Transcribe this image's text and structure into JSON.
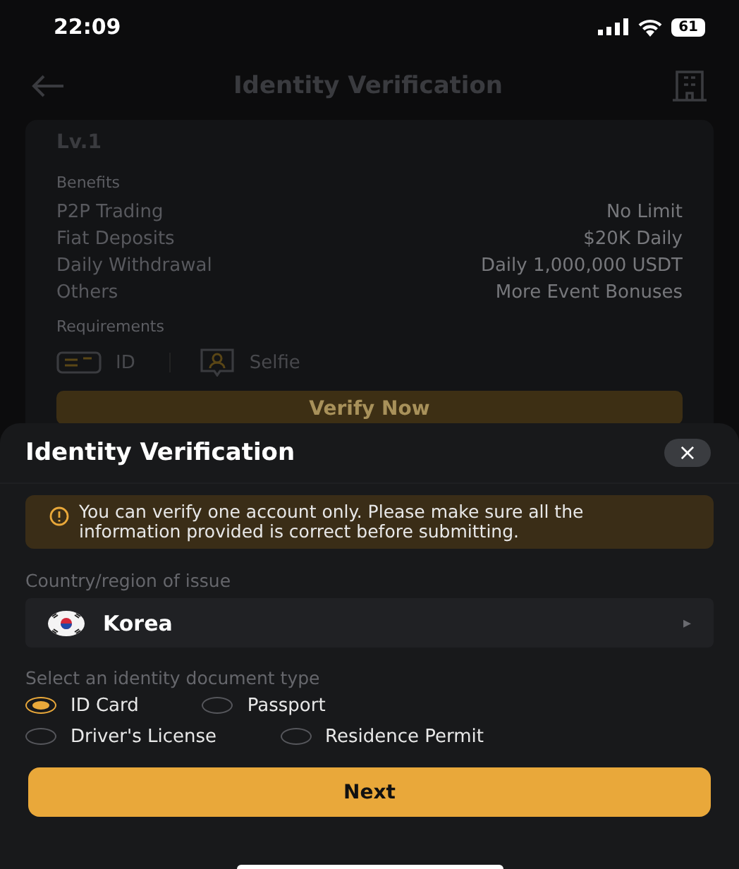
{
  "status_bar": {
    "time": "22:09",
    "battery": "61"
  },
  "header": {
    "title": "Identity Verification"
  },
  "level_card": {
    "level": "Lv.1",
    "benefits_label": "Benefits",
    "benefits": [
      {
        "name": "P2P Trading",
        "value": "No Limit"
      },
      {
        "name": "Fiat Deposits",
        "value": "$20K Daily"
      },
      {
        "name": "Daily Withdrawal",
        "value": "Daily 1,000,000 USDT"
      },
      {
        "name": "Others",
        "value": "More Event Bonuses"
      }
    ],
    "requirements_label": "Requirements",
    "requirements": [
      {
        "kind": "id",
        "label": "ID"
      },
      {
        "kind": "selfie",
        "label": "Selfie"
      }
    ],
    "button": "Verify Now"
  },
  "sheet": {
    "title": "Identity Verification",
    "close": "×",
    "notice": "You can verify one account only. Please make sure all the information provided is correct before submitting.",
    "country_label": "Country/region of issue",
    "country": "Korea",
    "chevron": "▸",
    "document_label": "Select an identity document type",
    "documents": [
      {
        "label": "ID Card",
        "selected": true
      },
      {
        "label": "Passport",
        "selected": false
      },
      {
        "label": "Driver's License",
        "selected": false
      },
      {
        "label": "Residence Permit",
        "selected": false
      }
    ],
    "next": "Next"
  }
}
